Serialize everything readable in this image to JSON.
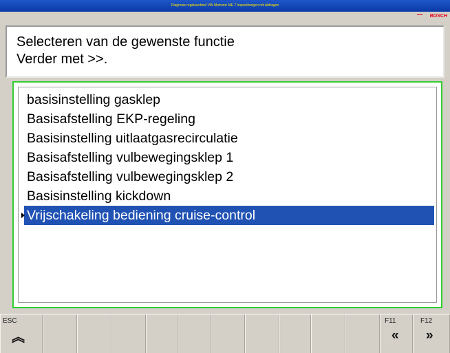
{
  "window": {
    "title": "Diagnose regeleenheid VW Motronic ME 7 Inspektiongen mit Abfragen",
    "brand": "BOSCH"
  },
  "instruction": {
    "line1": "Selecteren van de gewenste functie",
    "line2": "Verder met >>."
  },
  "functions": [
    {
      "label": "basisinstelling gasklep",
      "selected": false
    },
    {
      "label": "Basisafstelling EKP-regeling",
      "selected": false
    },
    {
      "label": "Basisinstelling uitlaatgasrecirculatie",
      "selected": false
    },
    {
      "label": "Basisafstelling vulbewegingsklep 1",
      "selected": false
    },
    {
      "label": "Basisafstelling vulbewegingsklep 2",
      "selected": false
    },
    {
      "label": "Basisinstelling kickdown",
      "selected": false
    },
    {
      "label": "Vrijschakeling bediening cruise-control",
      "selected": true
    }
  ],
  "toolbar": {
    "esc_label": "ESC",
    "esc_icon": "double-chevron-up-icon",
    "esc_glyph": "︽",
    "f11_label": "F11",
    "f11_icon": "double-chevron-left-icon",
    "f11_glyph": "«",
    "f12_label": "F12",
    "f12_icon": "double-chevron-right-icon",
    "f12_glyph": "»"
  },
  "colors": {
    "selection": "#2052b4",
    "list_border": "#33cc33",
    "title_bar": "#0a3aa6",
    "brand": "#e2001a"
  }
}
